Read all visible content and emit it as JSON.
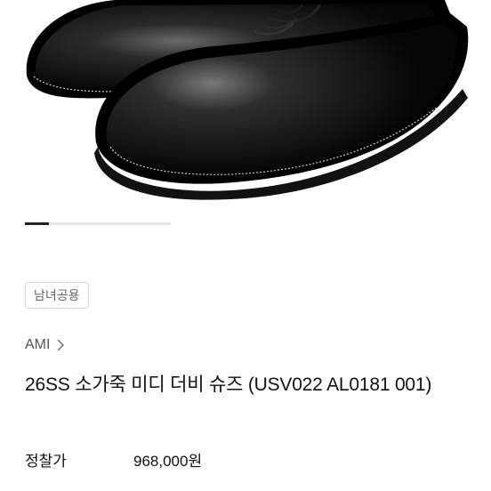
{
  "product": {
    "image_alt": "black leather shoes",
    "carousel": {
      "current": 1,
      "total": 6
    },
    "tag": "남녀공용",
    "brand": "AMI",
    "title": "26SS 소가죽 미디 더비 슈즈 (USV022 AL0181 001)",
    "price_label": "정찰가",
    "price": "968,000원"
  },
  "colors": {
    "leather": "#0c0c0c",
    "stitch": "#cfcfcf",
    "text_muted": "#666666"
  },
  "icons": {
    "brand_chevron": "chevron-right-icon"
  }
}
